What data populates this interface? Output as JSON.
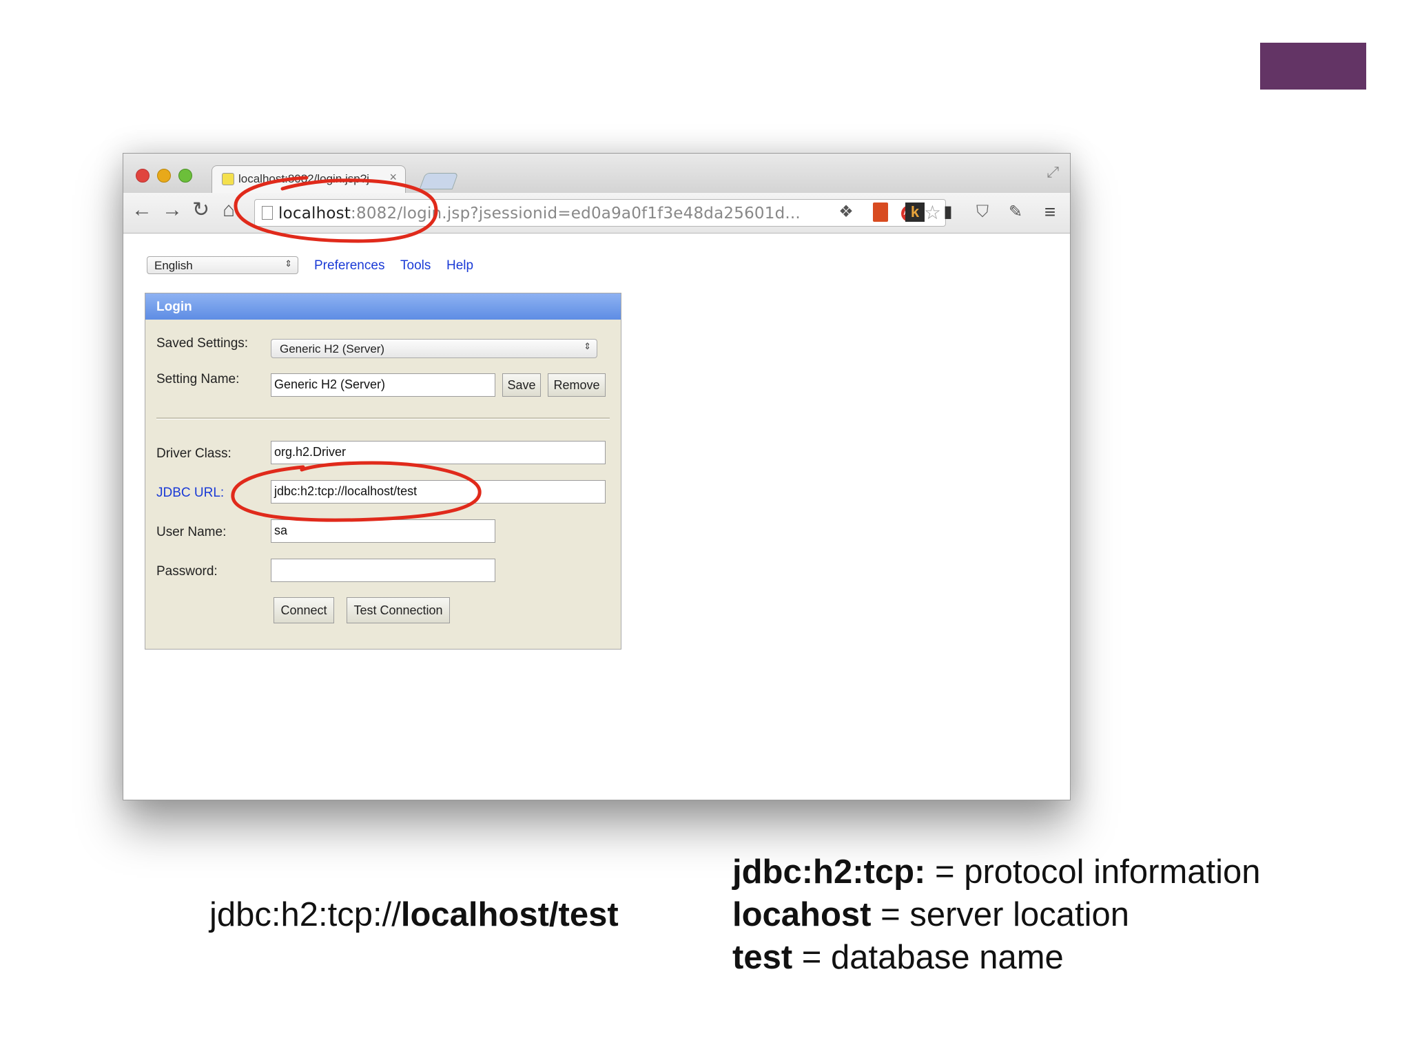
{
  "colors": {
    "accent": "#633465",
    "annotation": "#e02a1b",
    "link": "#1a3ad6",
    "panel": "#ebe8d8"
  },
  "browser": {
    "tab_title": "localhost:8082/login.jsp?j",
    "tab_close": "×",
    "url_host": "localhost",
    "url_rest": ":8082/login.jsp?jsessionid=ed0a9a0f1f3e48da25601d...",
    "abp_label": "ABP",
    "k_label": "k",
    "icons": [
      "back-icon",
      "forward-icon",
      "reload-icon",
      "home-icon",
      "page-icon",
      "adblock-icon",
      "star-icon",
      "evernote-icon",
      "bookmark-icon",
      "k-icon",
      "phone-icon",
      "pocket-icon",
      "wrench-icon",
      "menu-icon",
      "fullscreen-icon"
    ]
  },
  "page": {
    "language": "English",
    "links": {
      "preferences": "Preferences",
      "tools": "Tools",
      "help": "Help"
    },
    "login": {
      "header": "Login",
      "saved_settings_label": "Saved Settings:",
      "saved_settings_value": "Generic H2 (Server)",
      "setting_name_label": "Setting Name:",
      "setting_name_value": "Generic H2 (Server)",
      "save_button": "Save",
      "remove_button": "Remove",
      "driver_class_label": "Driver Class:",
      "driver_class_value": "org.h2.Driver",
      "jdbc_url_label": "JDBC URL:",
      "jdbc_url_value": "jdbc:h2:tcp://localhost/test",
      "user_name_label": "User Name:",
      "user_name_value": "sa",
      "password_label": "Password:",
      "password_value": "",
      "connect_button": "Connect",
      "test_connection_button": "Test Connection"
    }
  },
  "caption": {
    "prefix": "jdbc:h2:tcp://",
    "host": "localhost",
    "sep": "/",
    "db": "test"
  },
  "legend": [
    {
      "term": "jdbc:h2:tcp:",
      "desc": " = protocol information"
    },
    {
      "term": "locahost",
      "desc": " = server location"
    },
    {
      "term": "test",
      "desc": " = database name"
    }
  ]
}
